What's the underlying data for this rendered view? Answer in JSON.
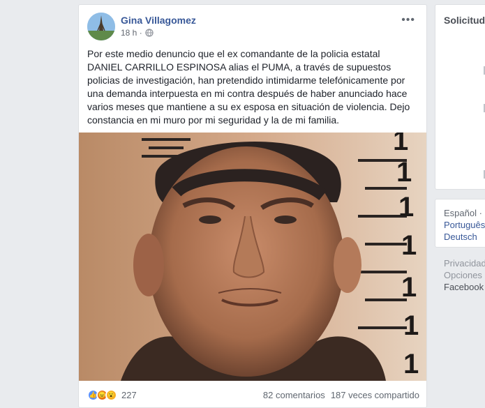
{
  "post": {
    "author": "Gina Villagomez",
    "time": "18 h ·",
    "more_icon": "more-dots-icon",
    "text": "Por este medio denuncio que el ex comandante de la policia estatal\nDANIEL CARRILLO ESPINOSA alias el PUMA, a través de supuestos\npolicias de investigación, han pretendido intimidarme telefónicamente por\nuna demanda interpuesta en mi contra después de haber anunciado hace\nvarios meses que mantiene a su ex esposa en situación de violencia. Dejo\nconstancia en mi muro por mi seguridad y la de mi familia.",
    "photo_ruler_numbers": [
      "1",
      "1",
      "1",
      "1",
      "1",
      "1",
      "1"
    ],
    "reactions": [
      "like",
      "angry",
      "wow"
    ],
    "reaction_count": "227",
    "comments": "82 comentarios",
    "shares": "187 veces compartido"
  },
  "sidebar": {
    "requests_title": "Solicitudes",
    "languages": {
      "current": "Español ·",
      "option_1": "Português",
      "option_2": "Deutsch"
    },
    "footer_links": [
      "Privacidad",
      "Opciones",
      "Facebook"
    ]
  },
  "colors": {
    "link": "#385898",
    "background": "#e9ebee",
    "like": "#5890ff",
    "angry": "#e9710f",
    "wow": "#f7b125"
  }
}
